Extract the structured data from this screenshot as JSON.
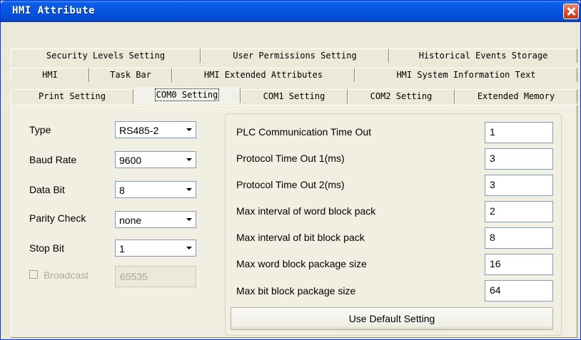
{
  "window": {
    "title": "HMI Attribute"
  },
  "tabs": {
    "row1": [
      "Security Levels Setting",
      "User Permissions Setting",
      "Historical Events Storage"
    ],
    "row2": [
      "HMI",
      "Task Bar",
      "HMI Extended Attributes",
      "HMI System Information Text"
    ],
    "row3": [
      "Print Setting",
      "COM0 Setting",
      "COM1 Setting",
      "COM2 Setting",
      "Extended Memory"
    ],
    "active": "COM0 Setting"
  },
  "serial": {
    "type": {
      "label": "Type",
      "value": "RS485-2"
    },
    "baud_rate": {
      "label": "Baud Rate",
      "value": "9600"
    },
    "data_bit": {
      "label": "Data Bit",
      "value": "8"
    },
    "parity_check": {
      "label": "Parity Check",
      "value": "none"
    },
    "stop_bit": {
      "label": "Stop Bit",
      "value": "1"
    },
    "broadcast": {
      "label": "Broadcast",
      "value": "65535",
      "checked": false,
      "enabled": false
    }
  },
  "timeouts": {
    "plc_timeout": {
      "label": "PLC Communication Time Out",
      "value": "1"
    },
    "protocol_timeout_1": {
      "label": "Protocol Time Out 1(ms)",
      "value": "3"
    },
    "protocol_timeout_2": {
      "label": "Protocol Time Out 2(ms)",
      "value": "3"
    },
    "word_block_interval": {
      "label": "Max interval of word block pack",
      "value": "2"
    },
    "bit_block_interval": {
      "label": "Max interval of bit block pack",
      "value": "8"
    },
    "word_block_size": {
      "label": "Max word block package size",
      "value": "16"
    },
    "bit_block_size": {
      "label": "Max bit block package size",
      "value": "64"
    }
  },
  "buttons": {
    "use_default": "Use Default Setting"
  },
  "colors": {
    "titlebar": "#0655e0",
    "close_button": "#d94b24",
    "dialog_bg": "#ece9d8",
    "field_border": "#7f9db9"
  }
}
